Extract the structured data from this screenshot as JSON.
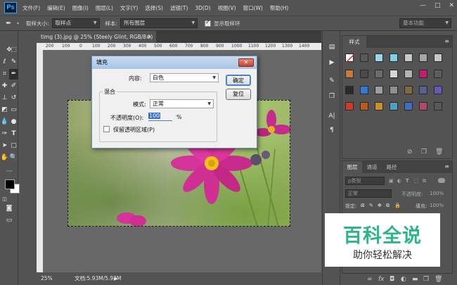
{
  "app": {
    "logo": "Ps",
    "menu": [
      "文件(F)",
      "编辑(E)",
      "图像(I)",
      "图层(L)",
      "文字(Y)",
      "选择(S)",
      "滤镜(T)",
      "3D(D)",
      "视图(V)",
      "窗口(W)",
      "帮助(H)"
    ],
    "window_controls": [
      "—",
      "□",
      "✕"
    ]
  },
  "options_bar": {
    "tool_icon": "eyedropper-icon",
    "sample_size_label": "取样大小:",
    "sample_size_value": "取样点",
    "sample_label": "样本:",
    "sample_value": "所有图层",
    "show_ring_label": "显示取样环",
    "show_ring_checked": true,
    "workspace": "基本功能"
  },
  "document": {
    "tab_title": "timg (3).jpg @ 25% (Steely Glint, RGB/8#) *",
    "tab_close": "×",
    "ruler_ticks": [
      "200",
      "100",
      "0",
      "100",
      "200",
      "300",
      "400",
      "500",
      "600",
      "700",
      "800",
      "900",
      "1000",
      "1100",
      "1200",
      "1300",
      "1400"
    ],
    "zoom": "25%",
    "doc_info": "文档:5.93M/5.93M"
  },
  "fill_dialog": {
    "title": "填充",
    "close": "✕",
    "content_label": "内容:",
    "content_value": "白色",
    "blend_group": "混合",
    "mode_label": "模式:",
    "mode_value": "正常",
    "opacity_label": "不透明度(O):",
    "opacity_value": "100",
    "opacity_unit": "%",
    "preserve_label": "保留透明区域(P)",
    "preserve_checked": false,
    "ok": "确定",
    "reset": "复位"
  },
  "styles_panel": {
    "tab": "样式",
    "swatch_colors": [
      "#ffffff",
      "#5a5a5a",
      "#9ad6e6",
      "#7fd0e0",
      "#c9c9c9",
      "#a6a6a6",
      "#c8c8c8",
      "#c77a3a",
      "#4a4a4a",
      "#6c6c6c",
      "#d8d8d8",
      "#b3b3b3",
      "#c21e6d",
      "#5d5d5d",
      "#2a2a2a",
      "#2f7bd6",
      "#9e9e9e",
      "#8f8f8f",
      "#806a40",
      "#5b5f8a",
      "#6e56b8",
      "#cd3b2d",
      "#bc5a1b",
      "#c8912c",
      "#4f9fbf",
      "#3f6fbf",
      "#b44a6a",
      "#585858"
    ]
  },
  "layers_panel": {
    "tabs": [
      "图层",
      "通道",
      "路径"
    ],
    "filter_label": "ρ类型",
    "blend_mode": "正常",
    "opacity_label": "不透明度:",
    "opacity_value": "100%",
    "lock_label": "锁定:",
    "fill_label": "填充:",
    "fill_value": "100%",
    "bottom_icons": [
      "link-icon",
      "fx-icon",
      "mask-icon",
      "adjustment-icon",
      "folder-icon",
      "new-layer-icon",
      "trash-icon"
    ]
  },
  "watermark": {
    "title": "百科全说",
    "subtitle": "助你轻松解决"
  }
}
